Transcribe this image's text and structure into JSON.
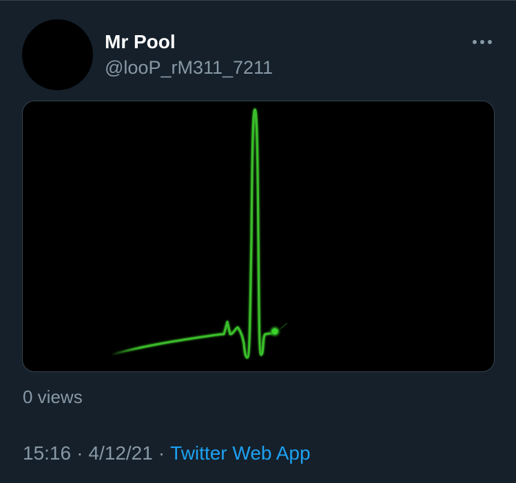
{
  "tweet": {
    "display_name": "Mr Pool",
    "handle": "@looP_rM311_7211",
    "more_icon": "more-horizontal-icon",
    "media": {
      "type": "video",
      "description_icon": "heartbeat-ecg-line",
      "line_color": "#3bbf2a"
    },
    "views": "0 views",
    "time": "15:16",
    "date": "4/12/21",
    "separator": "·",
    "source": "Twitter Web App"
  },
  "colors": {
    "background": "#15202b",
    "divider": "#38444d",
    "secondary_text": "#8899a6",
    "link": "#1da1f2"
  }
}
